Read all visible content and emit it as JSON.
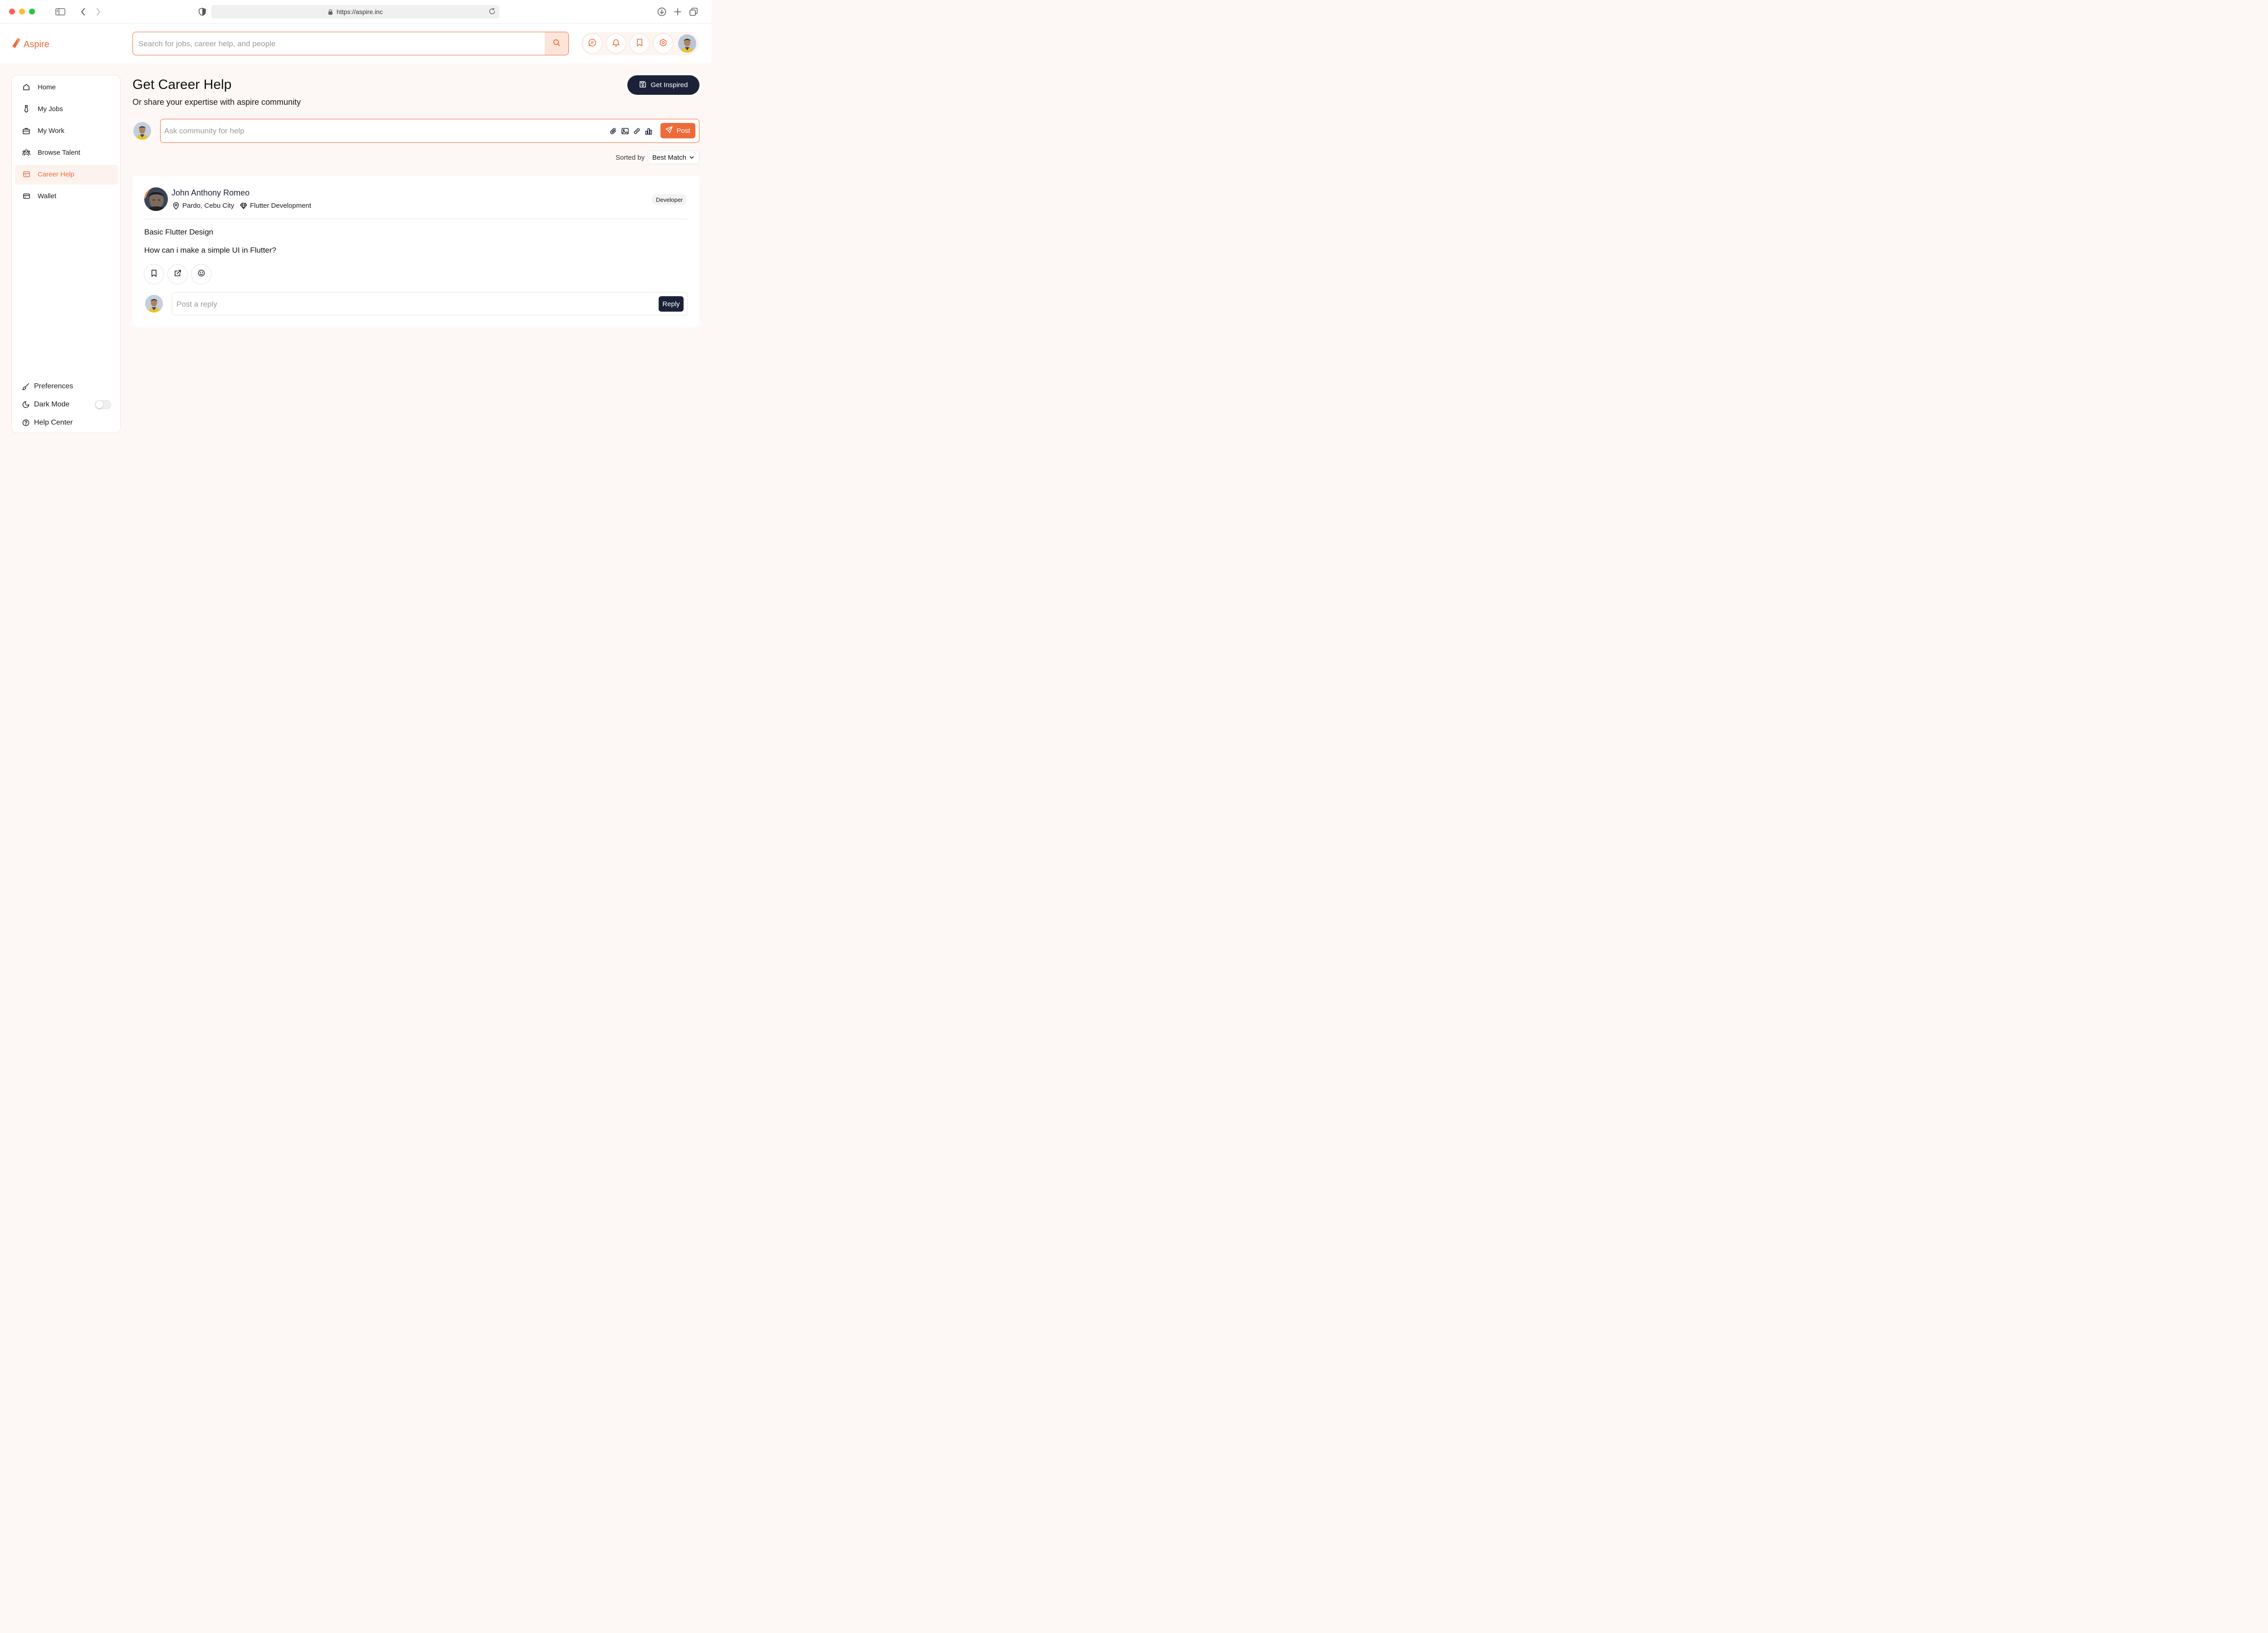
{
  "browser": {
    "url": "https://aspire.inc"
  },
  "header": {
    "logo_text": "Aspire",
    "search_placeholder": "Search for jobs, career help, and people"
  },
  "sidebar": {
    "items": [
      {
        "label": "Home",
        "icon": "home-icon"
      },
      {
        "label": "My Jobs",
        "icon": "tie-icon"
      },
      {
        "label": "My Work",
        "icon": "briefcase-icon"
      },
      {
        "label": "Browse Talent",
        "icon": "people-icon"
      },
      {
        "label": "Career Help",
        "icon": "calendar-icon",
        "active": true
      },
      {
        "label": "Wallet",
        "icon": "wallet-icon"
      }
    ],
    "bottom": {
      "preferences": "Preferences",
      "dark_mode": "Dark Mode",
      "dark_mode_on": false,
      "help_center": "Help Center"
    }
  },
  "main": {
    "title": "Get Career Help",
    "subtitle": "Or share your expertise with aspire community",
    "inspired_button": "Get Inspired",
    "ask_placeholder": "Ask community for help",
    "post_button": "Post",
    "sort_label": "Sorted by",
    "sort_value": "Best Match"
  },
  "post": {
    "author": "John Anthony Romeo",
    "location": "Pardo, Cebu City",
    "skill": "Flutter Development",
    "role": "Developer",
    "title": "Basic Flutter Design",
    "body": "How can i make a simple UI in Flutter?",
    "reply_placeholder": "Post a reply",
    "reply_button": "Reply"
  },
  "colors": {
    "accent": "#ee6a3a",
    "dark": "#1b2238",
    "background": "#fdf8f5"
  }
}
